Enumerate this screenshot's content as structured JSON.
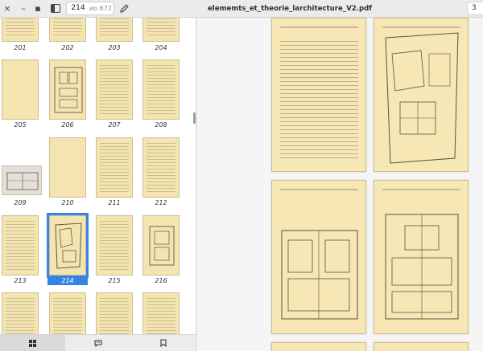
{
  "header": {
    "window_controls": [
      "×",
      "–",
      "▪"
    ],
    "sidebar_toggle_icon": "sidebar-toggle-icon",
    "current_page": "214",
    "page_count_label": "ио 672",
    "edit_icon": "pencil-icon",
    "title": "elememts_et_theorie_larchitecture_V2.pdf",
    "zoom_label": "3"
  },
  "thumbnails": [
    {
      "label": "201"
    },
    {
      "label": "202"
    },
    {
      "label": "203"
    },
    {
      "label": "204"
    },
    {
      "label": "205"
    },
    {
      "label": "206"
    },
    {
      "label": "207"
    },
    {
      "label": "208"
    },
    {
      "label": "209"
    },
    {
      "label": "210"
    },
    {
      "label": "211"
    },
    {
      "label": "212"
    },
    {
      "label": "213"
    },
    {
      "label": "214"
    },
    {
      "label": "215"
    },
    {
      "label": "216"
    }
  ],
  "selected_page": "214",
  "tabs": [
    {
      "icon": "grid-icon"
    },
    {
      "icon": "annotations-icon"
    },
    {
      "icon": "bookmark-icon"
    }
  ],
  "colors": {
    "accent": "#3584e4",
    "page_paper": "#f6e7b4"
  }
}
